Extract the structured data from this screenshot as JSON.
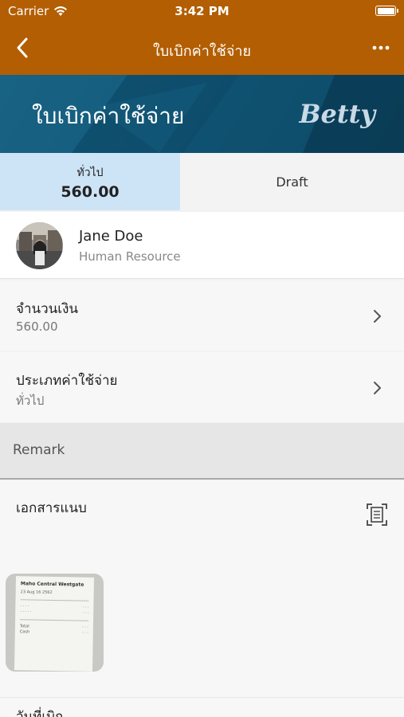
{
  "status_bar": {
    "carrier": "Carrier",
    "time": "3:42 PM"
  },
  "nav": {
    "title": "ใบเบิกค่าใช้จ่าย"
  },
  "banner": {
    "heading": "ใบเบิกค่าใช้จ่าย",
    "brand": "Betty"
  },
  "tabs": {
    "general": {
      "label": "ทั่วไป",
      "amount": "560.00"
    },
    "draft": {
      "label": "Draft"
    }
  },
  "user": {
    "name": "Jane Doe",
    "department": "Human Resource"
  },
  "fields": {
    "amount": {
      "label": "จำนวนเงิน",
      "value": "560.00"
    },
    "expense_type": {
      "label": "ประเภทค่าใช้จ่าย",
      "value": "ทั่วไป"
    }
  },
  "remark": {
    "placeholder": "Remark"
  },
  "attachments": {
    "label": "เอกสารแนบ",
    "receipt": {
      "store": "Maho Central Westgate",
      "date": "23 Aug 16 2562",
      "lines": [
        "Total",
        "Cash"
      ]
    }
  },
  "next_field": {
    "label": "วันที่เบิก"
  },
  "colors": {
    "header": "#b35e03",
    "banner": "#0e4d6b",
    "active_tab": "#cde4f7"
  }
}
